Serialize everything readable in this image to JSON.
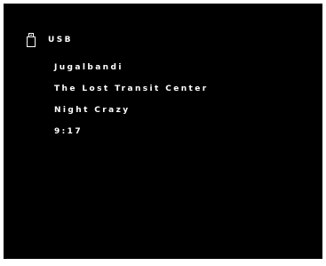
{
  "source": {
    "icon": "usb-icon",
    "label": "USB"
  },
  "track": {
    "album": "Jugalbandi",
    "title": "The Lost Transit Center",
    "artist": "Night Crazy",
    "elapsed_time": "9:17"
  },
  "colors": {
    "background": "#000000",
    "text": "#ffffff"
  }
}
